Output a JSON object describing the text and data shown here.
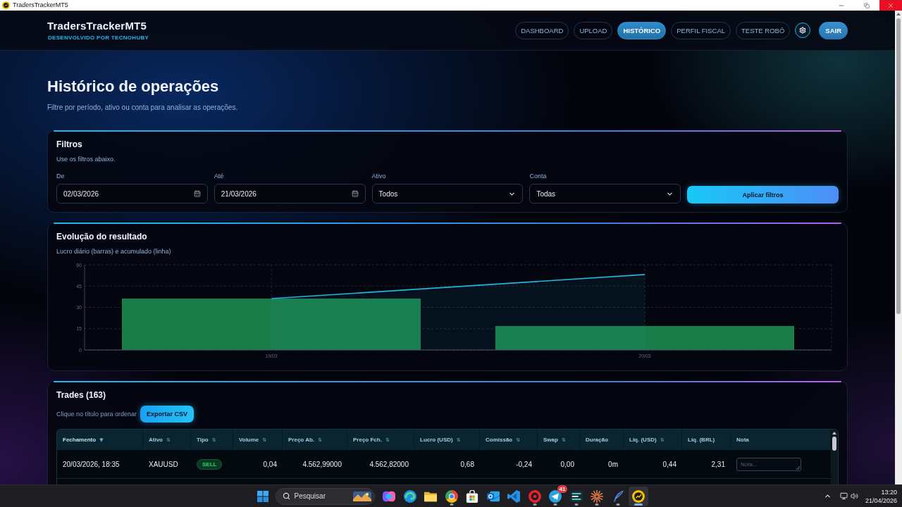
{
  "window": {
    "title": "TradersTrackerMT5"
  },
  "header": {
    "brand": "TradersTrackerMT5",
    "tagline": "DESENVOLVIDO POR TECNOHUBY",
    "nav": [
      {
        "label": "DASHBOARD",
        "selected": false
      },
      {
        "label": "UPLOAD",
        "selected": false
      },
      {
        "label": "HISTÓRICO",
        "selected": true
      },
      {
        "label": "PERFIL FISCAL",
        "selected": false
      },
      {
        "label": "TESTE ROBÔ",
        "selected": false
      }
    ],
    "logout": "SAIR"
  },
  "page": {
    "title": "Histórico de operações",
    "subtitle": "Filtre por período, ativo ou conta para analisar as operações."
  },
  "filters": {
    "title": "Filtros",
    "subtitle": "Use os filtros abaixo.",
    "fields": [
      {
        "kind": "date",
        "label": "De",
        "value": "02/03/2026"
      },
      {
        "kind": "date",
        "label": "Até",
        "value": "21/03/2026"
      },
      {
        "kind": "select",
        "label": "Ativo",
        "value": "Todos"
      },
      {
        "kind": "select",
        "label": "Conta",
        "value": "Todas"
      }
    ],
    "apply_button": "Aplicar filtros"
  },
  "chart": {
    "title": "Evolução do resultado",
    "subtitle": "Lucro diário (barras) e acumulado (linha)",
    "chart_data": {
      "type": "bar",
      "categories": [
        "19/03",
        "20/03"
      ],
      "ylim": [
        0,
        60
      ],
      "yticks": [
        0,
        15,
        30,
        45,
        60
      ],
      "grid": true,
      "series": [
        {
          "color": "#1a7c48",
          "values": [
            36.2,
            16.9
          ]
        },
        {
          "type": "area",
          "color": "#22b6de",
          "values": [
            36.2,
            53.1
          ]
        }
      ]
    }
  },
  "trades": {
    "title": "Trades (163)",
    "hint": "Clique no título para ordenar",
    "export_button": "Exportar CSV",
    "table": {
      "columns": [
        {
          "label": "Fechamento",
          "sort_mark": "▼",
          "sorted": true
        },
        {
          "label": "Ativo",
          "sort_mark": "⇅",
          "sorted": false
        },
        {
          "label": "Tipo",
          "sort_mark": "⇅",
          "sorted": false
        },
        {
          "label": "Volume",
          "sort_mark": "⇅",
          "sorted": false
        },
        {
          "label": "Preço Ab.",
          "sort_mark": "⇅",
          "sorted": false
        },
        {
          "label": "Preço Fch.",
          "sort_mark": "⇅",
          "sorted": false
        },
        {
          "label": "Lucro (USD)",
          "sort_mark": "⇅",
          "sorted": false
        },
        {
          "label": "Comissão",
          "sort_mark": "⇅",
          "sorted": false
        },
        {
          "label": "Swap",
          "sort_mark": "⇅",
          "sorted": false
        },
        {
          "label": "Duração",
          "sorted": false
        },
        {
          "label": "Liq. (USD)",
          "sort_mark": "⇅",
          "sorted": false
        },
        {
          "label": "Liq. (BRL)",
          "sorted": false
        },
        {
          "label": "Nota",
          "sorted": false
        }
      ],
      "rows": [
        {
          "cells": [
            {
              "kind": "text",
              "text": "20/03/2026, 18:35"
            },
            {
              "kind": "text",
              "text": "XAUUSD"
            },
            {
              "kind": "badge",
              "text": "SELL"
            },
            {
              "kind": "number",
              "text": "0,04"
            },
            {
              "kind": "number",
              "text": "4.562,99000"
            },
            {
              "kind": "number",
              "text": "4.562,82000"
            },
            {
              "kind": "number",
              "text": "0,68"
            },
            {
              "kind": "number",
              "text": "-0,24"
            },
            {
              "kind": "number",
              "text": "0,00"
            },
            {
              "kind": "number",
              "text": "0m"
            },
            {
              "kind": "number",
              "text": "0,44"
            },
            {
              "kind": "number",
              "text": "2,31"
            },
            {
              "kind": "note",
              "placeholder": "Nota..."
            }
          ]
        }
      ]
    }
  },
  "taskbar": {
    "search": {
      "placeholder": "Pesquisar"
    },
    "apps": [
      {
        "kind": "blob",
        "running": false,
        "selected": false
      },
      {
        "kind": "swirl",
        "running": false,
        "selected": false
      },
      {
        "kind": "folder",
        "running": false,
        "selected": false
      },
      {
        "kind": "wheel",
        "running": true,
        "selected": false
      },
      {
        "kind": "bag",
        "running": false,
        "selected": false
      },
      {
        "kind": "mail",
        "running": false,
        "selected": false
      },
      {
        "kind": "code",
        "running": false,
        "selected": false
      },
      {
        "kind": "ring",
        "running": true,
        "selected": false
      },
      {
        "kind": "plane",
        "running": true,
        "selected": false,
        "badge": "41"
      },
      {
        "kind": "bars",
        "running": true,
        "selected": false
      },
      {
        "kind": "sunburst",
        "running": true,
        "selected": false
      },
      {
        "kind": "quill",
        "running": true,
        "selected": false
      },
      {
        "kind": "coin",
        "running": true,
        "selected": true
      }
    ],
    "clock": {
      "time": "13:20",
      "date": "21/04/2026"
    }
  }
}
